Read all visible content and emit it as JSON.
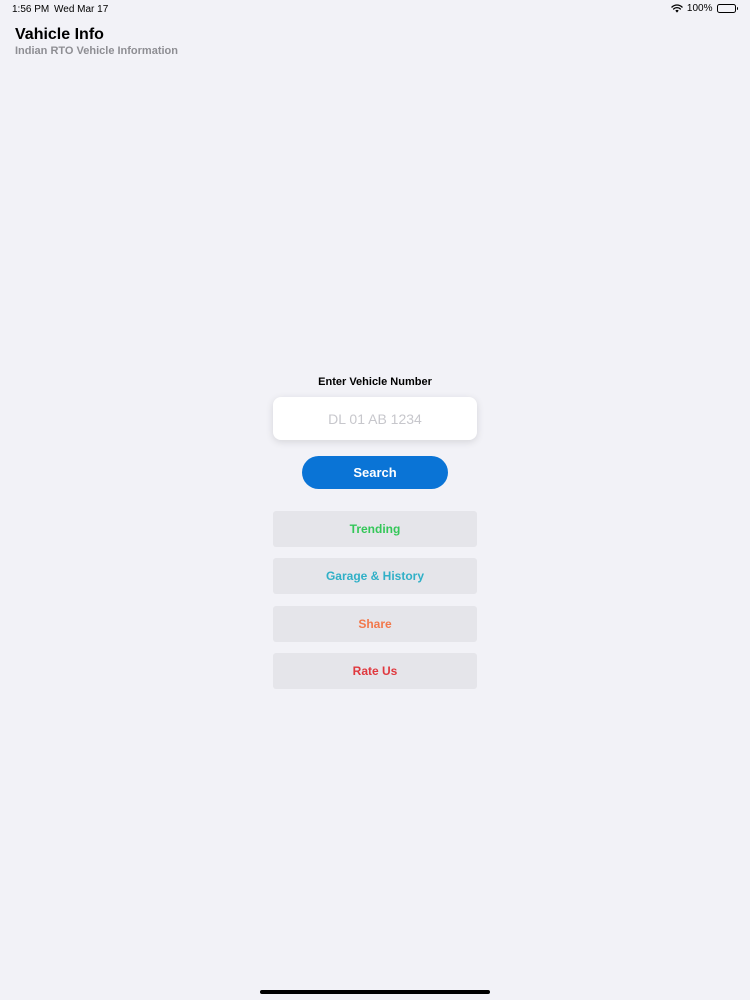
{
  "status_bar": {
    "time": "1:56 PM",
    "date": "Wed Mar 17",
    "battery": "100%",
    "wifi_icon": "wifi-icon",
    "battery_icon": "battery-icon"
  },
  "header": {
    "title": "Vahicle Info",
    "subtitle": "Indian RTO Vehicle Information"
  },
  "form": {
    "label": "Enter Vehicle Number",
    "input_value": "",
    "input_placeholder": "DL 01 AB 1234",
    "search_label": "Search"
  },
  "menu": {
    "trending": "Trending",
    "garage": "Garage & History",
    "share": "Share",
    "rate": "Rate Us"
  },
  "colors": {
    "background": "#f2f2f7",
    "search_button": "#0a74d6",
    "trending": "#34c759",
    "garage": "#30b0c7",
    "share": "#f2784b",
    "rate": "#e0383e"
  }
}
